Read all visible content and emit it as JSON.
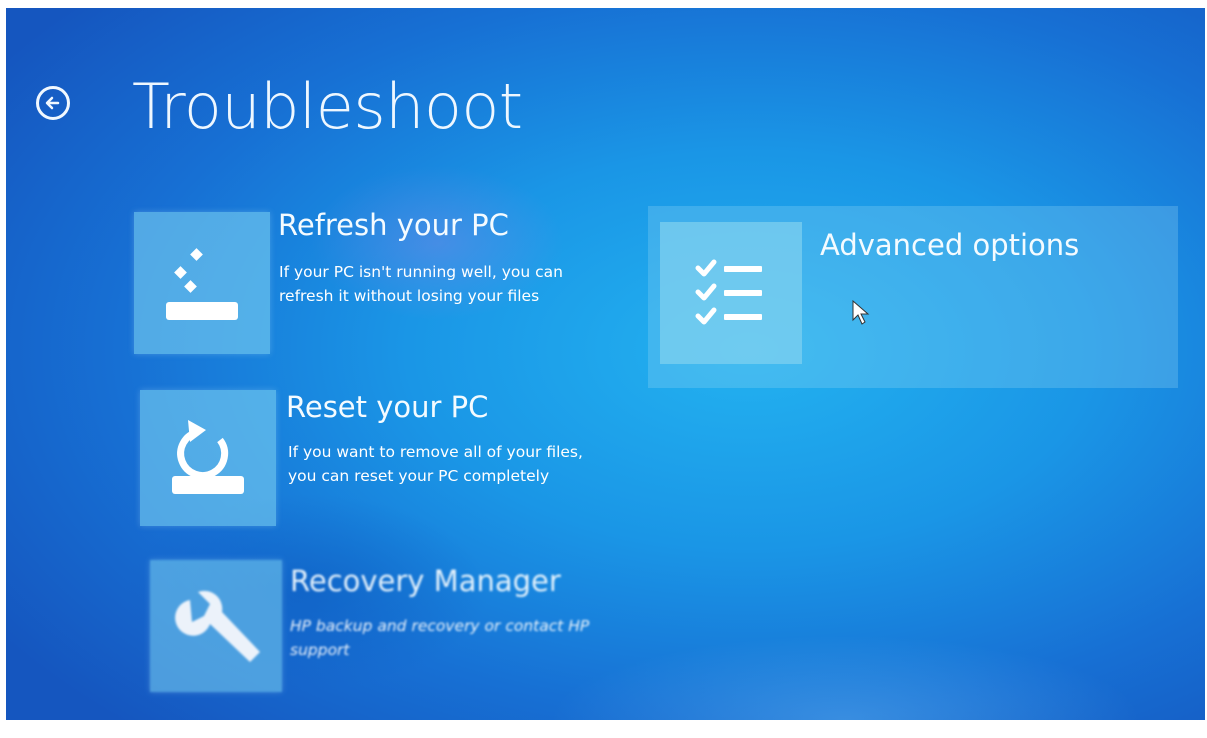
{
  "header": {
    "title": "Troubleshoot",
    "back_icon": "back-arrow-circle-icon"
  },
  "options": [
    {
      "title": "Refresh your PC",
      "description": "If your PC isn't running well, you can refresh it without losing your files",
      "icon": "refresh-pc-icon"
    },
    {
      "title": "Reset your PC",
      "description": "If you want to remove all of your files, you can reset your PC completely",
      "icon": "reset-pc-icon"
    },
    {
      "title": "Recovery Manager",
      "description": "HP backup and recovery or contact HP support",
      "icon": "wrench-icon"
    }
  ],
  "advanced": {
    "title": "Advanced options",
    "icon": "checklist-icon"
  },
  "colors": {
    "background": "#1a96e6",
    "tile": "#78cdf0",
    "text": "#ffffff"
  }
}
